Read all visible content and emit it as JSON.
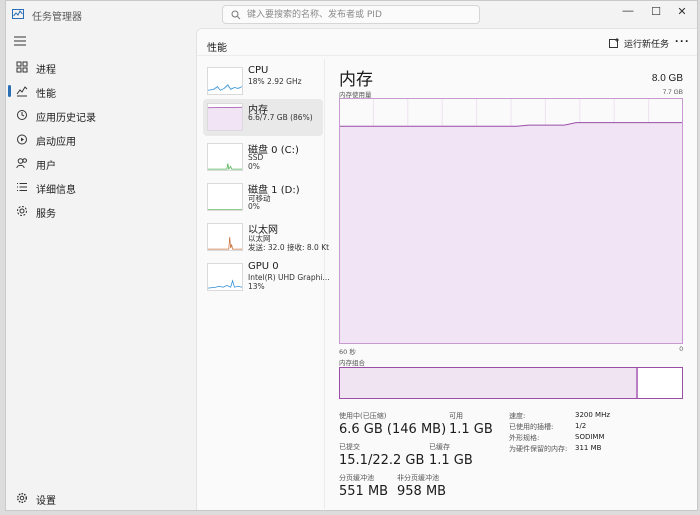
{
  "app": {
    "title": "任务管理器"
  },
  "search": {
    "placeholder": "键入要搜索的名称、发布者或 PID"
  },
  "window_controls": {
    "minimize": "—",
    "maximize": "☐",
    "close": "✕"
  },
  "nav": {
    "items": [
      {
        "label": "进程",
        "icon": "processes-icon"
      },
      {
        "label": "性能",
        "icon": "performance-icon",
        "active": true
      },
      {
        "label": "应用历史记录",
        "icon": "history-icon"
      },
      {
        "label": "启动应用",
        "icon": "startup-icon"
      },
      {
        "label": "用户",
        "icon": "users-icon"
      },
      {
        "label": "详细信息",
        "icon": "details-icon"
      },
      {
        "label": "服务",
        "icon": "services-icon"
      }
    ],
    "settings": {
      "label": "设置",
      "icon": "gear-icon"
    }
  },
  "header": {
    "title": "性能",
    "run_task": "运行新任务",
    "more": "···"
  },
  "devices": [
    {
      "name": "CPU",
      "line1": "18%  2.92 GHz",
      "line2": ""
    },
    {
      "name": "内存",
      "line1": "6.6/7.7 GB (86%)",
      "line2": "",
      "active": true
    },
    {
      "name": "磁盘 0 (C:)",
      "line1": "SSD",
      "line2": "0%"
    },
    {
      "name": "磁盘 1 (D:)",
      "line1": "可移动",
      "line2": "0%"
    },
    {
      "name": "以太网",
      "line1": "以太网",
      "line2": "发送: 32.0  接收: 8.0 Kt"
    },
    {
      "name": "GPU 0",
      "line1": "Intel(R) UHD Graphi...",
      "line2": "13%"
    }
  ],
  "memory": {
    "title": "内存",
    "total": "8.0 GB",
    "usage_label": "内存使用量",
    "usage_max": "7.7 GB",
    "axis_left": "60 秒",
    "axis_right": "0",
    "composition_label": "内存组合",
    "composition_used_fraction": 0.87,
    "usage_fraction_history": [
      0.885,
      0.885,
      0.885,
      0.885,
      0.885,
      0.885,
      0.885,
      0.885,
      0.885,
      0.885,
      0.885,
      0.885,
      0.885,
      0.885,
      0.885,
      0.885,
      0.89,
      0.89,
      0.89,
      0.89,
      0.9,
      0.9,
      0.9,
      0.9,
      0.9,
      0.9,
      0.9,
      0.9,
      0.9,
      0.9
    ],
    "line_color": "#9b4da8",
    "fill_color": "#f1e4f4",
    "stats": [
      {
        "key": "使用中(已压缩)",
        "value": "6.6 GB (146 MB)"
      },
      {
        "key": "可用",
        "value": "1.1 GB"
      },
      {
        "key": "已提交",
        "value": "15.1/22.2 GB"
      },
      {
        "key": "已缓存",
        "value": "1.1 GB"
      },
      {
        "key": "分页缓冲池",
        "value": "551 MB"
      },
      {
        "key": "非分页缓冲池",
        "value": "958 MB"
      }
    ],
    "specs": [
      {
        "key": "速度:",
        "value": "3200 MHz"
      },
      {
        "key": "已使用的插槽:",
        "value": "1/2"
      },
      {
        "key": "外形规格:",
        "value": "SODIMM"
      },
      {
        "key": "为硬件保留的内存:",
        "value": "311 MB"
      }
    ]
  }
}
